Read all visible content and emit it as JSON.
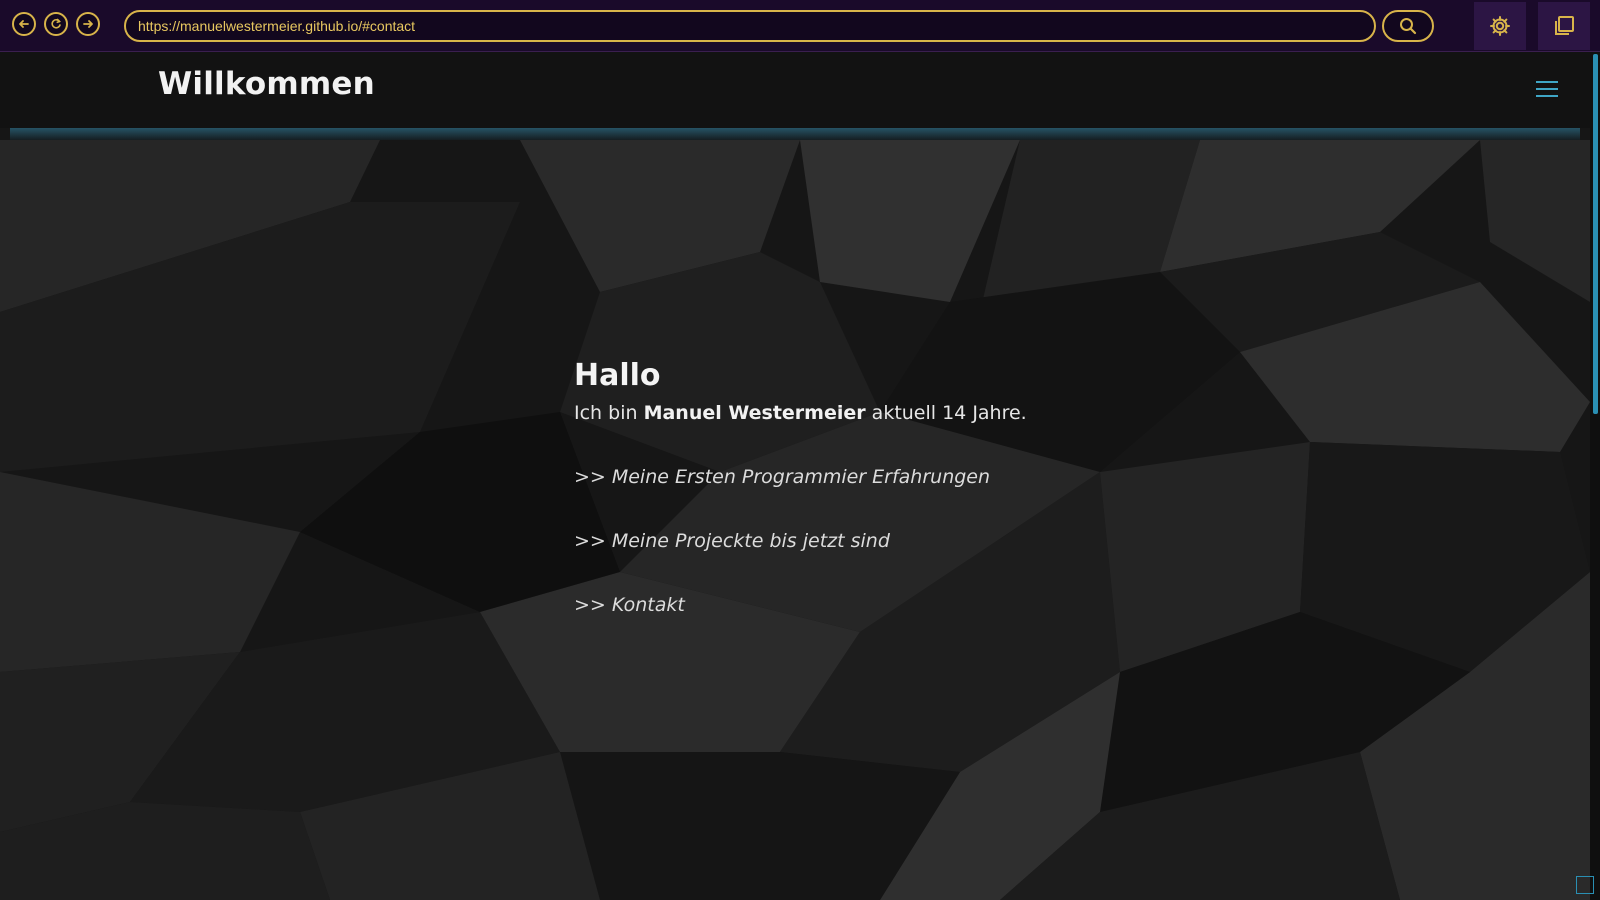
{
  "browser": {
    "url": "https://manuelwestermeier.github.io/#contact"
  },
  "header": {
    "title": "Willkommen"
  },
  "main": {
    "heading": "Hallo",
    "intro_prefix": "Ich bin",
    "intro_name": "Manuel Westermeier",
    "intro_suffix": "aktuell 14 Jahre.",
    "links": [
      {
        "arrow": ">>",
        "label": "Meine Ersten Programmier Erfahrungen"
      },
      {
        "arrow": ">>",
        "label": "Meine Projeckte bis jetzt sind"
      },
      {
        "arrow": ">>",
        "label": "Kontakt"
      }
    ]
  },
  "icons": {
    "back": "arrow-left-icon",
    "reload": "reload-icon",
    "forward": "arrow-right-icon",
    "search": "search-icon",
    "settings": "gear-icon",
    "tabs": "tabs-icon",
    "menu": "hamburger-menu-icon"
  },
  "colors": {
    "chrome_accent": "#d8b44a",
    "chrome_bg": "#1a0a2a",
    "site_accent": "#3fa6c6"
  }
}
